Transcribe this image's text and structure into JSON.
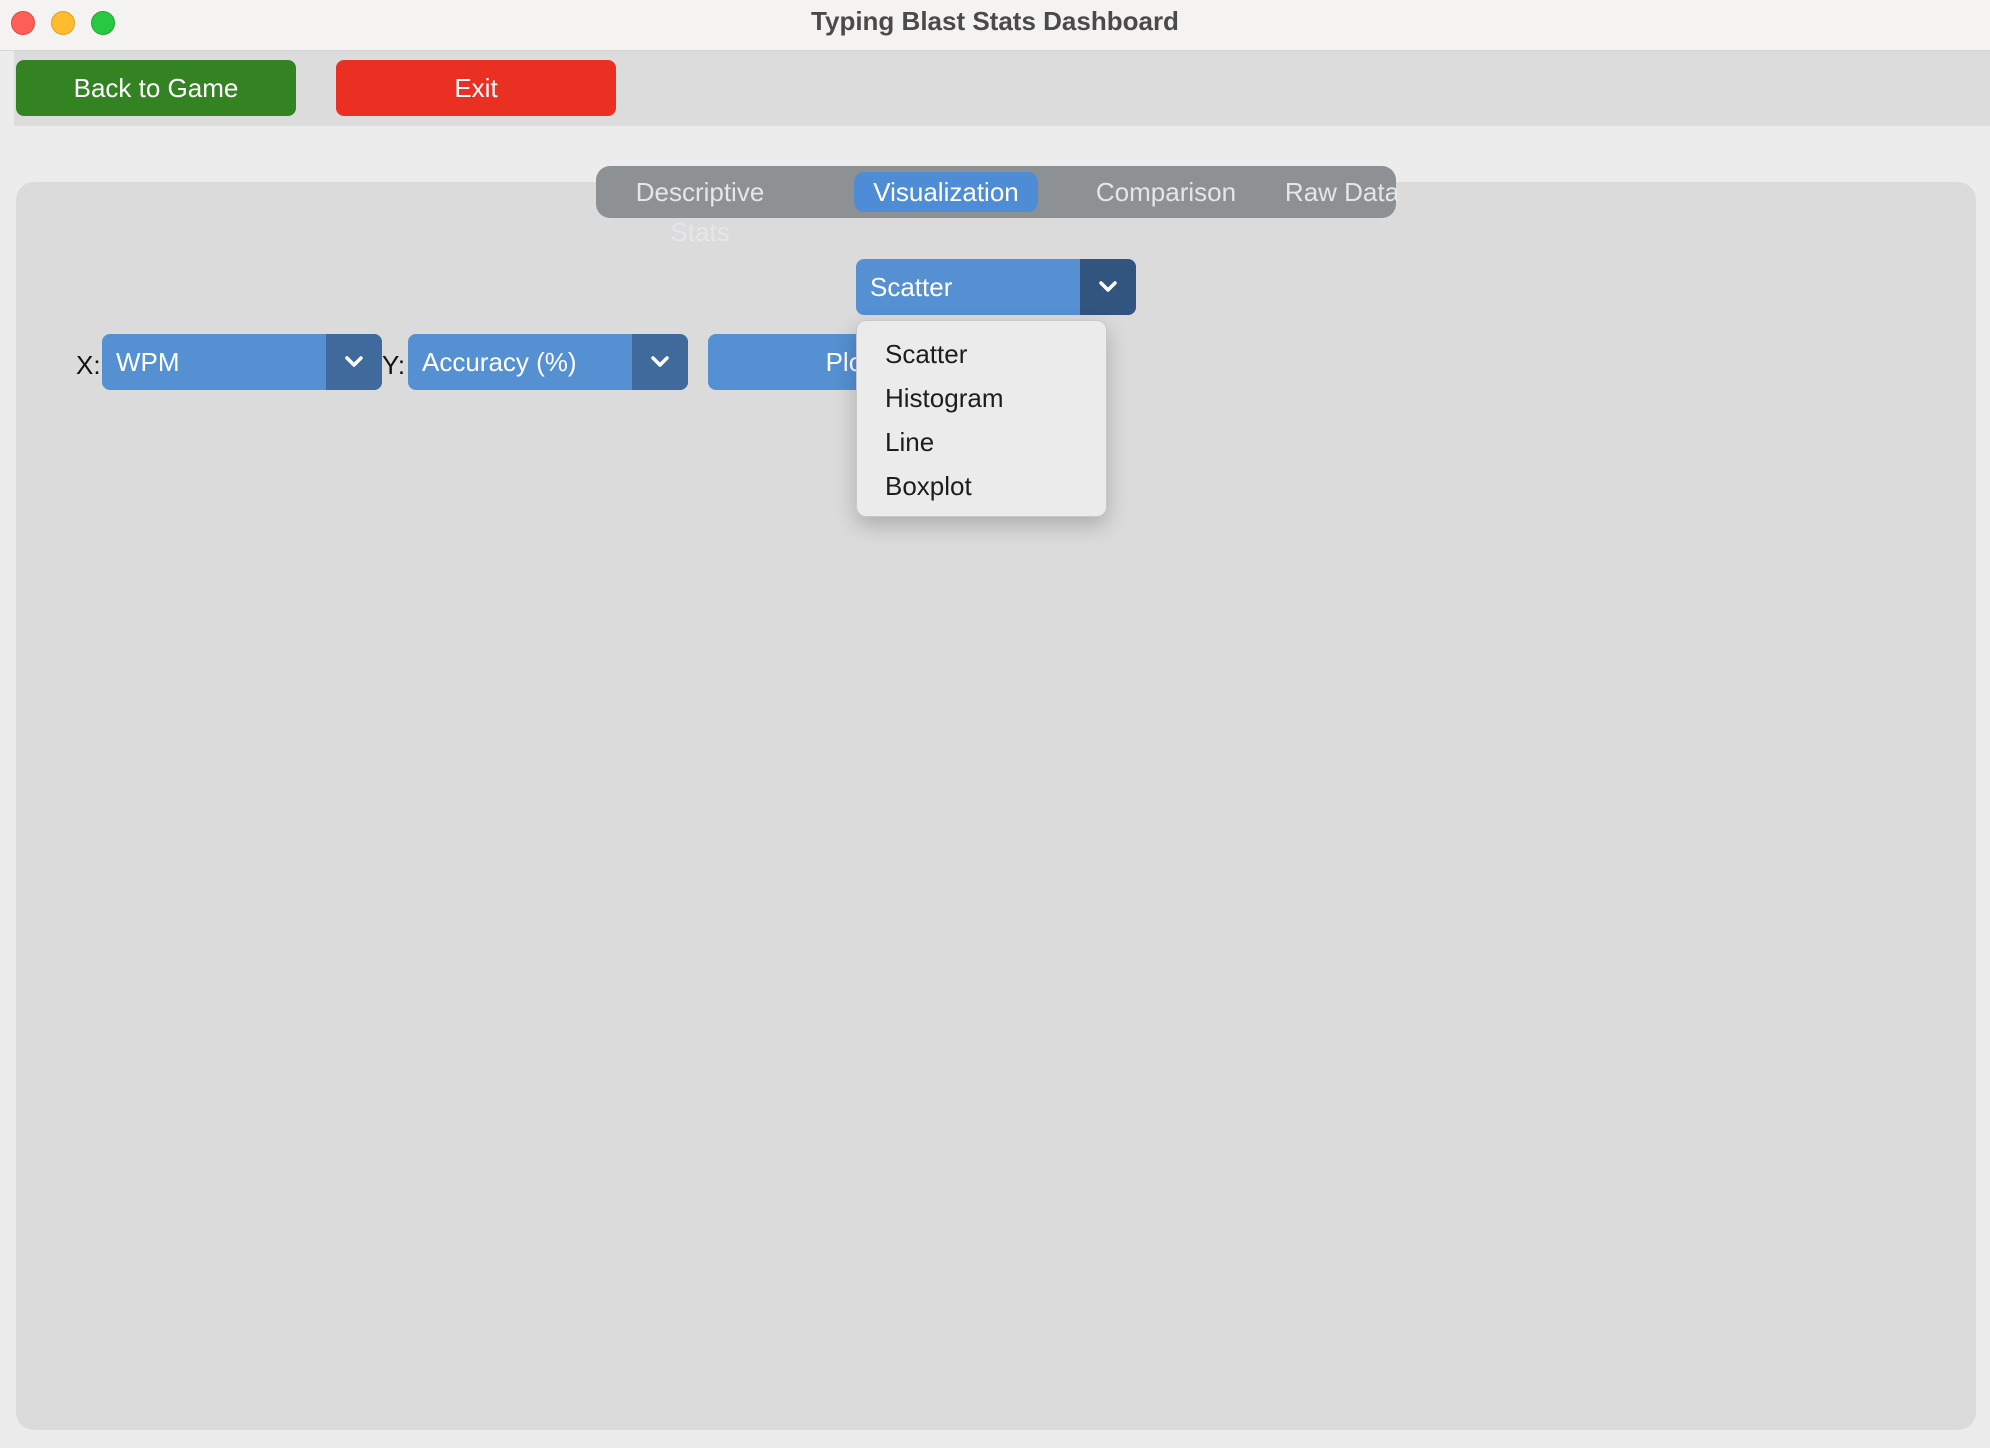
{
  "window": {
    "title": "Typing Blast Stats Dashboard"
  },
  "toolbar": {
    "back_label": "Back to Game",
    "exit_label": "Exit"
  },
  "tabs": [
    {
      "label": "Descriptive Stats",
      "active": false
    },
    {
      "label": "Visualization",
      "active": true
    },
    {
      "label": "Comparison",
      "active": false
    },
    {
      "label": "Raw Data",
      "active": false
    }
  ],
  "visualization": {
    "plot_type": {
      "selected": "Scatter",
      "options": [
        "Scatter",
        "Histogram",
        "Line",
        "Boxplot"
      ]
    },
    "x_axis": {
      "label": "X:",
      "selected": "WPM"
    },
    "y_axis": {
      "label": "Y:",
      "selected": "Accuracy (%)"
    },
    "plot_button_label": "Plot"
  },
  "colors": {
    "back_button": "#348323",
    "exit_button": "#ea3023",
    "accent": "#5590d3",
    "active_tab": "#4e8cd6"
  }
}
